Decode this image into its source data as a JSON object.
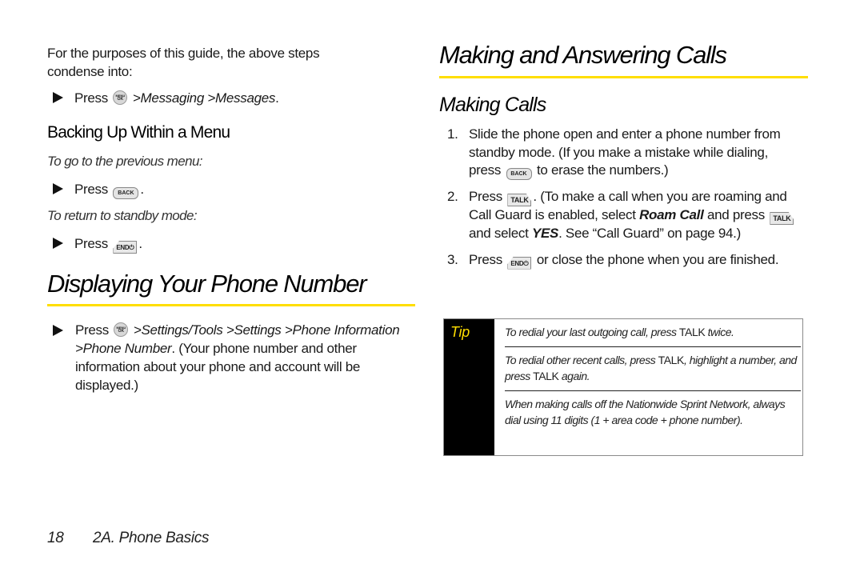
{
  "left_column": {
    "intro": "For the purposes of this guide, the above steps condense into:",
    "intro_step": {
      "press": "Press",
      "key_icon": "menu-ok-key",
      "key_top": "MENU",
      "key_bottom": "OK",
      "path": ">Messaging >Messages",
      "end": "."
    },
    "backing_up": {
      "heading": "Backing Up Within a Menu",
      "previous_label": "To go to the previous menu:",
      "previous_step": {
        "press": "Press",
        "key_icon": "back-key",
        "key_text": "BACK",
        "end": "."
      },
      "standby_label": "To return to standby mode:",
      "standby_step": {
        "press": "Press",
        "key_icon": "end-key",
        "key_text": "END⏻",
        "end": "."
      }
    },
    "displaying": {
      "heading": "Displaying Your Phone Number",
      "step": {
        "press": "Press",
        "key_icon": "menu-ok-key",
        "key_top": "MENU",
        "key_bottom": "OK",
        "path": ">Settings/Tools >Settings >Phone Information >Phone Number",
        "rest": ". (Your phone number and other information about your phone and account will be displayed.)"
      }
    }
  },
  "right_column": {
    "heading": "Making and Answering Calls",
    "subheading": "Making Calls",
    "steps": [
      {
        "num": "1.",
        "text_a": "Slide the phone open and enter a phone number from standby mode. (If you make a mistake while dialing, press",
        "key_text": "BACK",
        "text_b": "to erase the numbers.)"
      },
      {
        "num": "2.",
        "text_a": "Press",
        "key_text": "TALK",
        "text_b": ". (To make a call when you are roaming and Call Guard is enabled, select",
        "em1": "Roam Call",
        "text_c": "and press",
        "key_text2": "TALK",
        "text_d": "and select",
        "em2": "YES",
        "text_e": ". See “Call Guard” on page 94.)"
      },
      {
        "num": "3.",
        "text_a": "Press",
        "key_text": "END⏻",
        "text_b": "or close the phone when you are finished."
      }
    ],
    "tip": {
      "label": "Tip",
      "items": [
        {
          "a": "To redial your last outgoing call, press ",
          "cap": "TALK",
          "b": " twice."
        },
        {
          "a": "To redial other recent calls, press ",
          "cap": "TALK",
          "b": ", highlight a number, and press ",
          "cap2": "TALK",
          "c": " again."
        },
        {
          "a": "When making calls off the Nationwide Sprint Network, always dial using 11 digits (1 + area code + phone number)."
        }
      ]
    }
  },
  "footer": {
    "page_number": "18",
    "section": "2A. Phone Basics"
  },
  "colors": {
    "accent_yellow": "#ffde00",
    "tip_sidebar": "#000000"
  }
}
